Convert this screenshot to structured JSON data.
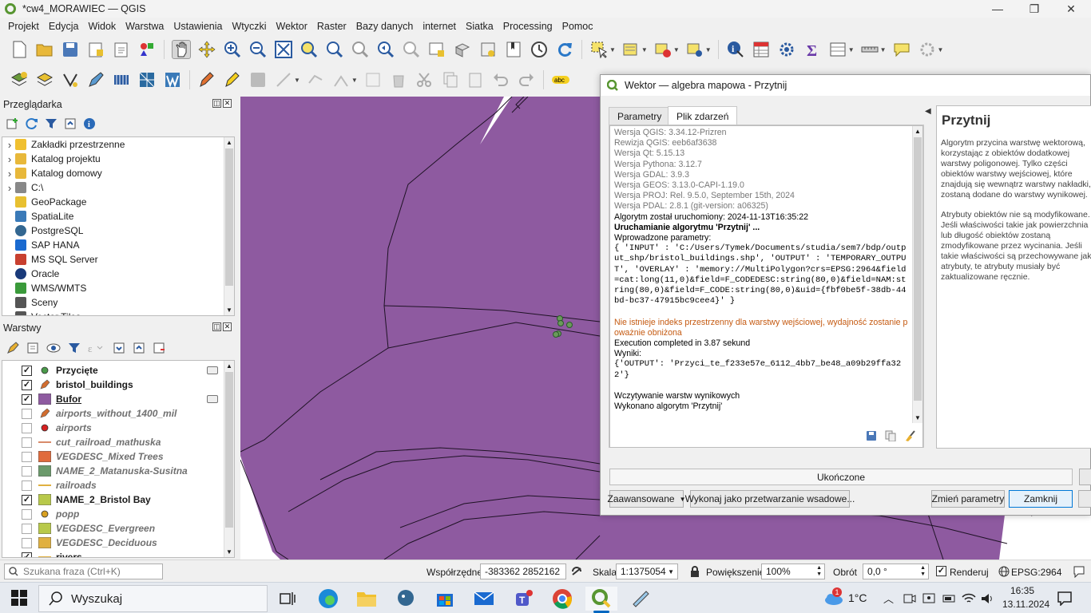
{
  "window": {
    "title": "*cw4_MORAWIEC — QGIS"
  },
  "menu": [
    "Projekt",
    "Edycja",
    "Widok",
    "Warstwa",
    "Ustawienia",
    "Wtyczki",
    "Wektor",
    "Raster",
    "Bazy danych",
    "internet",
    "Siatka",
    "Processing",
    "Pomoc"
  ],
  "browser": {
    "title": "Przeglądarka",
    "items": [
      {
        "label": "Zakładki przestrzenne",
        "icon": "star-icon"
      },
      {
        "label": "Katalog projektu",
        "icon": "folder-icon"
      },
      {
        "label": "Katalog domowy",
        "icon": "home-folder-icon"
      },
      {
        "label": "C:\\",
        "icon": "drive-icon"
      },
      {
        "label": "GeoPackage",
        "icon": "geopackage-icon"
      },
      {
        "label": "SpatiaLite",
        "icon": "spatialite-icon"
      },
      {
        "label": "PostgreSQL",
        "icon": "postgresql-icon"
      },
      {
        "label": "SAP HANA",
        "icon": "sap-hana-icon"
      },
      {
        "label": "MS SQL Server",
        "icon": "mssql-icon"
      },
      {
        "label": "Oracle",
        "icon": "oracle-icon"
      },
      {
        "label": "WMS/WMTS",
        "icon": "wms-icon"
      },
      {
        "label": "Sceny",
        "icon": "scenes-icon"
      },
      {
        "label": "Vector Tiles",
        "icon": "vector-tiles-icon"
      }
    ]
  },
  "layers": {
    "title": "Warstwy",
    "items": [
      {
        "label": "Przycięte",
        "checked": true,
        "symbol": "point",
        "color": "#4a9a4a",
        "dim": false
      },
      {
        "label": "bristol_buildings",
        "checked": true,
        "symbol": "polygon-warn",
        "color": "#d26d2f",
        "dim": false
      },
      {
        "label": "Bufor",
        "checked": true,
        "symbol": "fill",
        "color": "#8e5aa0",
        "dim": false,
        "underline": true
      },
      {
        "label": "airports_without_1400_mil",
        "checked": false,
        "symbol": "polygon-warn",
        "color": "#d26d2f",
        "dim": true
      },
      {
        "label": "airports",
        "checked": false,
        "symbol": "point",
        "color": "#d62020",
        "dim": true
      },
      {
        "label": "cut_railroad_mathuska",
        "checked": false,
        "symbol": "line",
        "color": "#d88a6a",
        "dim": true
      },
      {
        "label": "VEGDESC_Mixed Trees",
        "checked": false,
        "symbol": "fill",
        "color": "#e06b3c",
        "dim": true
      },
      {
        "label": "NAME_2_Matanuska-Susitna",
        "checked": false,
        "symbol": "fill",
        "color": "#6b9a6b",
        "dim": true
      },
      {
        "label": "railroads",
        "checked": false,
        "symbol": "line",
        "color": "#e0b040",
        "dim": true
      },
      {
        "label": "NAME_2_Bristol Bay",
        "checked": true,
        "symbol": "fill",
        "color": "#b8c94a",
        "dim": false
      },
      {
        "label": "popp",
        "checked": false,
        "symbol": "point",
        "color": "#d8a020",
        "dim": true
      },
      {
        "label": "VEGDESC_Evergreen",
        "checked": false,
        "symbol": "fill",
        "color": "#b8c94a",
        "dim": true
      },
      {
        "label": "VEGDESC_Deciduous",
        "checked": false,
        "symbol": "fill",
        "color": "#e0b040",
        "dim": true
      },
      {
        "label": "rivers",
        "checked": true,
        "symbol": "line",
        "color": "#e0b040",
        "dim": false
      }
    ]
  },
  "dialog": {
    "title": "Wektor — algebra mapowa - Przytnij",
    "tabs": [
      "Parametry",
      "Plik zdarzeń"
    ],
    "log": [
      {
        "cls": "lg",
        "text": "Wersja QGIS: 3.34.12-Prizren"
      },
      {
        "cls": "lg",
        "text": "Rewizja QGIS: eeb6af3638"
      },
      {
        "cls": "lg",
        "text": "Wersja Qt: 5.15.13"
      },
      {
        "cls": "lg",
        "text": "Wersja Pythona: 3.12.7"
      },
      {
        "cls": "lg",
        "text": "Wersja GDAL: 3.9.3"
      },
      {
        "cls": "lg",
        "text": "Wersja GEOS: 3.13.0-CAPI-1.19.0"
      },
      {
        "cls": "lg",
        "text": "Wersja PROJ: Rel. 9.5.0, September 15th, 2024"
      },
      {
        "cls": "lg",
        "text": "Wersja PDAL: 2.8.1 (git-version: a06325)"
      },
      {
        "cls": "lb",
        "text": "Algorytm został uruchomiony: 2024-11-13T16:35:22"
      },
      {
        "cls": "lb lbold",
        "text": "Uruchamianie algorytmu 'Przytnij' ..."
      },
      {
        "cls": "lb",
        "text": "Wprowadzone parametry:"
      },
      {
        "cls": "lb lmono",
        "text": "{ 'INPUT' : 'C:/Users/Tymek/Documents/studia/sem7/bdp/output_shp/bristol_buildings.shp', 'OUTPUT' : 'TEMPORARY_OUTPUT', 'OVERLAY' : 'memory://MultiPolygon?crs=EPSG:2964&field=cat:long(11,0)&field=F_CODEDESC:string(80,0)&field=NAM:string(80,0)&field=F_CODE:string(80,0)&uid={fbf0be5f-38db-44bd-bc37-47915bc9cee4}' }"
      },
      {
        "cls": "lb",
        "text": " "
      },
      {
        "cls": "lwarn",
        "text": "Nie istnieje indeks przestrzenny dla warstwy wejściowej, wydajność zostanie poważnie obniżona"
      },
      {
        "cls": "lb",
        "text": "Execution completed in 3.87 sekund"
      },
      {
        "cls": "lb",
        "text": "Wyniki:"
      },
      {
        "cls": "lb lmono",
        "text": "{'OUTPUT': 'Przyci_te_f233e57e_6112_4bb7_be48_a09b29ffa322'}"
      },
      {
        "cls": "lb",
        "text": " "
      },
      {
        "cls": "lb",
        "text": "Wczytywanie warstw wynikowych"
      },
      {
        "cls": "lb",
        "text": "Wykonano algorytm 'Przytnij'"
      }
    ],
    "help": {
      "title": "Przytnij",
      "p1": "Algorytm przycina warstwę wektorową, korzystając z obiektów dodatkowej warstwy poligonowej. Tylko części obiektów warstwy wejściowej, które znajdują się wewnątrz warstwy nakładki, zostaną dodane do warstwy wynikowej.",
      "p2": "Atrybuty obiektów nie są modyfikowane. Jeśli właściwości takie jak powierzchnia lub długość obiektów zostaną zmodyfikowane przez wycinania. Jeśli takie właściwości są przechowywane jako atrybuty, te atrybuty musiały być zaktualizowane ręcznie."
    },
    "progress": "Ukończone",
    "buttons": {
      "advanced": "Zaawansowane",
      "batch": "Wykonaj jako przetwarzanie wsadowe...",
      "change": "Zmień parametry",
      "close": "Zamknij"
    }
  },
  "statusbar": {
    "search_placeholder": "Szukana fraza (Ctrl+K)",
    "coord_label": "Współrzędne",
    "coord_value": "-383362  2852162",
    "scale_label": "Skala",
    "scale_value": "1:1375054",
    "magnifier_label": "Powiększenie",
    "magnifier_value": "100%",
    "rotation_label": "Obrót",
    "rotation_value": "0,0 °",
    "render_label": "Renderuj",
    "crs": "EPSG:2964"
  },
  "taskbar": {
    "search": "Wyszukaj",
    "weather": "1°C",
    "weather_badge": "1",
    "time": "16:35",
    "date": "13.11.2024"
  }
}
